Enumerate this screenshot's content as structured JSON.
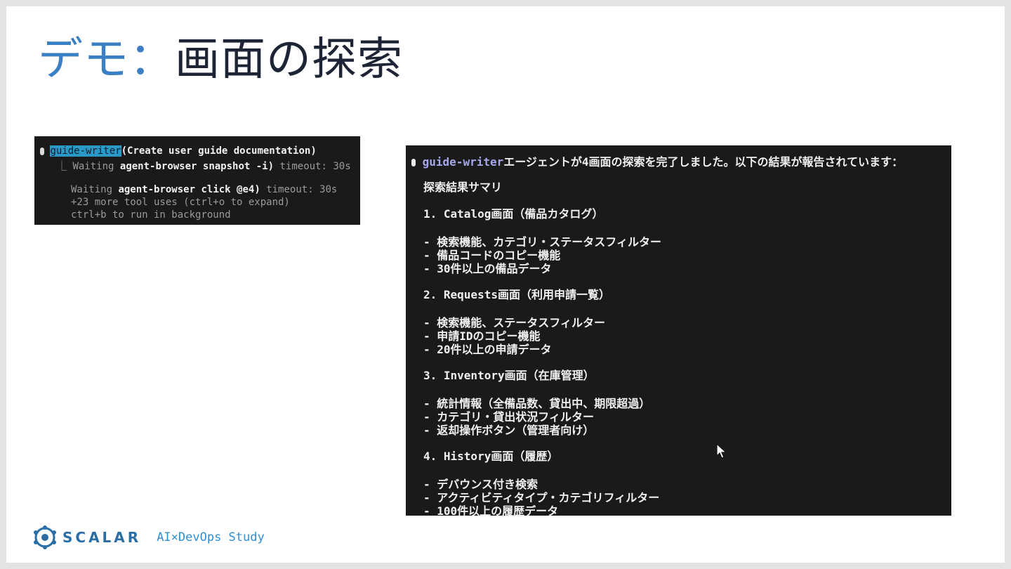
{
  "slide": {
    "title_prefix": "デモ：",
    "title_main": "画面の探索"
  },
  "terminal_small": {
    "agent_name": "guide-writer",
    "call_args": "(Create user guide documentation)",
    "line2_prefix": "⎿ ",
    "line2_status": "Waiting",
    "line2_command": "agent-browser snapshot -i)",
    "line2_timeout": "timeout: 30s",
    "line3_status": "Waiting",
    "line3_command": "agent-browser click @e4)",
    "line3_timeout": "timeout: 30s",
    "line4": "+23 more tool uses (ctrl+o to expand)",
    "line5": "ctrl+b to run in background"
  },
  "terminal_main": {
    "agent_name": "guide-writer",
    "intro": "エージェントが4画面の探索を完了しました。以下の結果が報告されています：",
    "summary_title": "探索結果サマリ",
    "sections": [
      {
        "heading": "1. Catalog画面（備品カタログ）",
        "items": [
          "- 検索機能、カテゴリ・ステータスフィルター",
          "- 備品コードのコピー機能",
          "- 30件以上の備品データ"
        ]
      },
      {
        "heading": "2. Requests画面（利用申請一覧）",
        "items": [
          "- 検索機能、ステータスフィルター",
          "- 申請IDのコピー機能",
          "- 20件以上の申請データ"
        ]
      },
      {
        "heading": "3. Inventory画面（在庫管理）",
        "items": [
          "- 統計情報（全備品数、貸出中、期限超過）",
          "- カテゴリ・貸出状況フィルター",
          "- 返却操作ボタン（管理者向け）"
        ]
      },
      {
        "heading": "4. History画面（履歴）",
        "items": [
          "- デバウンス付き検索",
          "- アクティビティタイプ・カテゴリフィルター",
          "- 100件以上の履歴データ"
        ]
      }
    ]
  },
  "footer": {
    "logo_text": "SCALAR",
    "subtitle": "AI×DevOps Study"
  },
  "colors": {
    "title_accent": "#3b7fc4",
    "title_main": "#1d2435",
    "terminal_bg": "#1a1a1a",
    "agent_highlight": "#2a99c8",
    "agent_name_color": "#a7a8ea",
    "logo_blue": "#2b6ea6"
  }
}
